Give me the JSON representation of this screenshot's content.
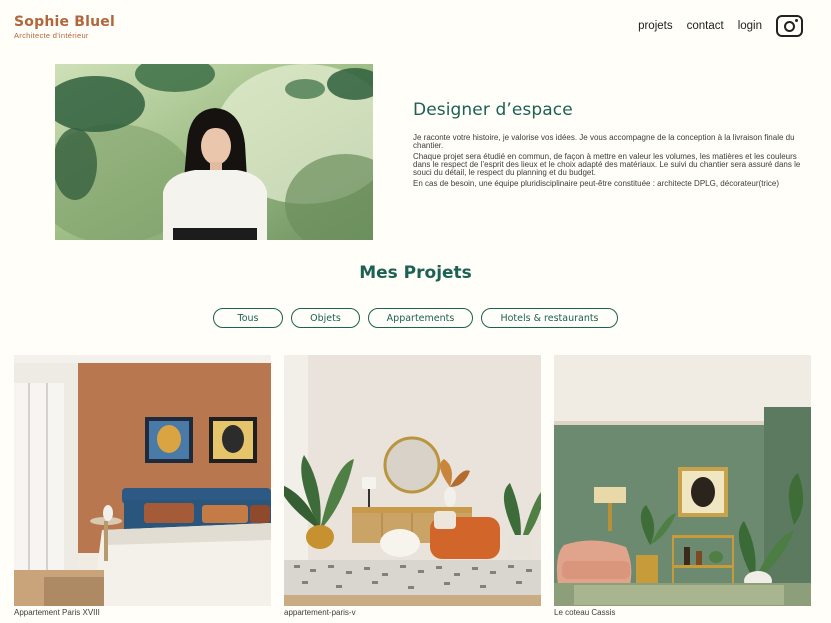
{
  "header": {
    "logo_title": "Sophie Bluel",
    "logo_subtitle": "Architecte d'intérieur",
    "nav": [
      "projets",
      "contact",
      "login"
    ],
    "instagram_icon": "instagram-icon"
  },
  "introduction": {
    "title": "Designer d’espace",
    "paragraphs": [
      "Je raconte votre histoire, je valorise vos idées. Je vous accompagne de la conception à la livraison finale du chantier.",
      "Chaque projet sera étudié en commun, de façon à mettre en valeur les volumes, les matières et les couleurs dans le respect de l’esprit des lieux et le choix adapté des matériaux. Le suivi du chantier sera assuré dans le souci du détail, le respect du planning et du budget.",
      "En cas de besoin, une équipe pluridisciplinaire peut-être constituée : architecte DPLG, décorateur(trice)"
    ]
  },
  "portfolio": {
    "title": "Mes Projets",
    "filters": [
      "Tous",
      "Objets",
      "Appartements",
      "Hotels & restaurants"
    ],
    "projects": [
      {
        "caption": "Appartement Paris XVIII"
      },
      {
        "caption": "appartement-paris-v"
      },
      {
        "caption": "Le coteau Cassis"
      }
    ]
  },
  "colors": {
    "accent": "#1d6154",
    "logo": "#b1663c",
    "background": "#fffef8"
  }
}
